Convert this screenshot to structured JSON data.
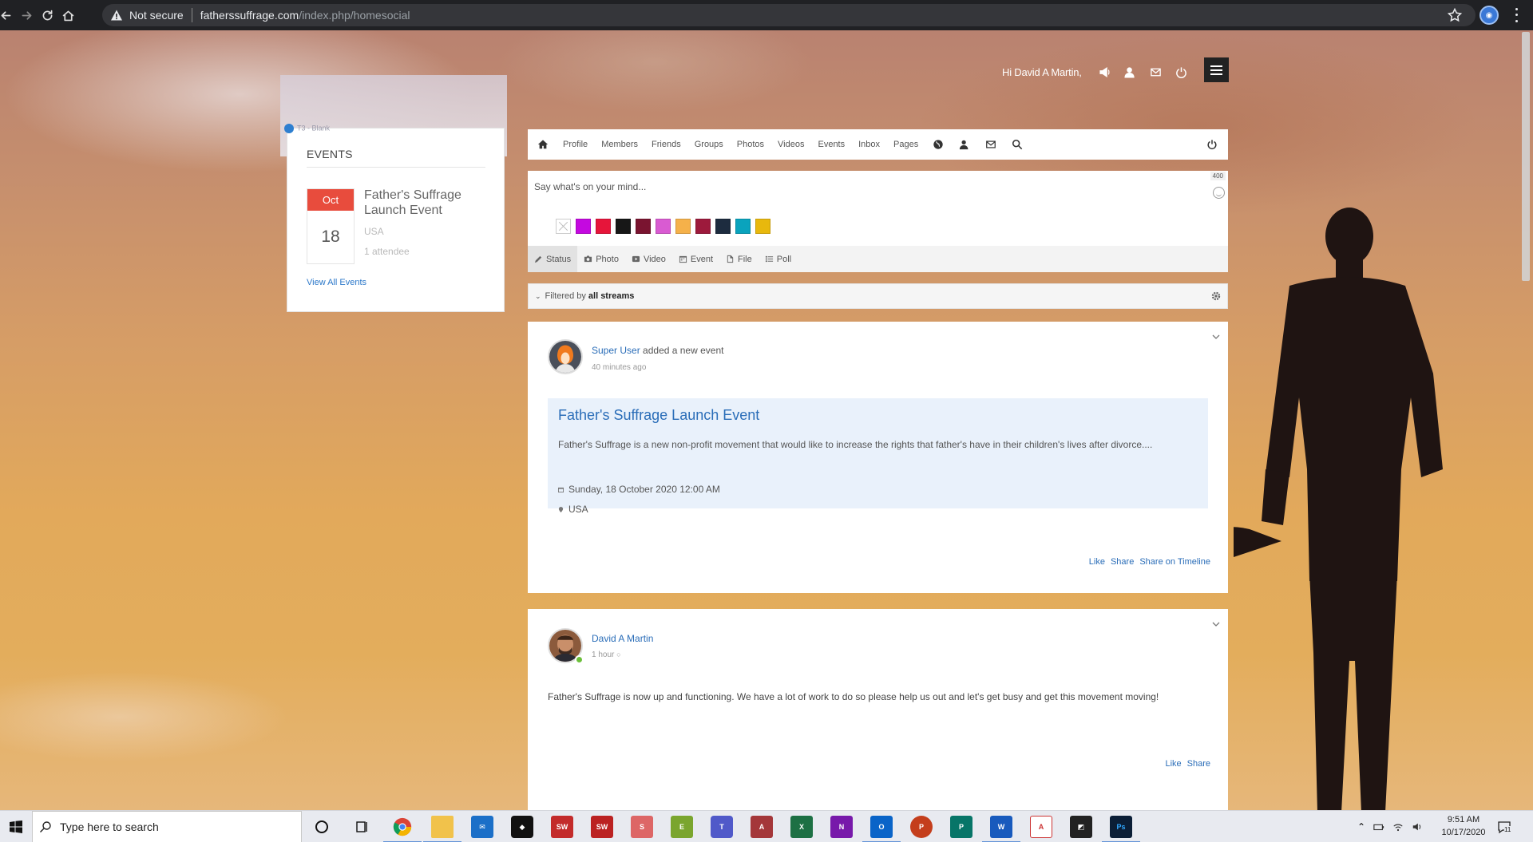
{
  "browser": {
    "security_label": "Not secure",
    "url_host": "fatherssuffrage.com",
    "url_path": "/index.php/homesocial"
  },
  "userbar": {
    "greeting": "Hi David A Martin,"
  },
  "events_widget": {
    "logo_text": "T3 - Blank",
    "heading": "EVENTS",
    "event": {
      "month": "Oct",
      "day": "18",
      "title": "Father's Suffrage Launch Event",
      "location": "USA",
      "attendees": "1 attendee"
    },
    "view_all": "View All Events"
  },
  "nav": {
    "items": [
      "Profile",
      "Members",
      "Friends",
      "Groups",
      "Photos",
      "Videos",
      "Events",
      "Inbox",
      "Pages"
    ]
  },
  "composer": {
    "placeholder": "Say what's on your mind...",
    "char_limit": "400",
    "tabs": [
      "Status",
      "Photo",
      "Video",
      "Event",
      "File",
      "Poll"
    ],
    "swatches": [
      "none",
      "#c409e0",
      "#e6153a",
      "#171717",
      "#7a1430",
      "#d95bd2",
      "#f5b14a",
      "#9d1a3c",
      "#1d2c3f",
      "#0aa3bd",
      "#e8b80d"
    ]
  },
  "filter": {
    "prefix": "Filtered by",
    "value": "all streams"
  },
  "posts": [
    {
      "author": "Super User",
      "action": "added a new event",
      "time": "40 minutes ago",
      "event_title": "Father's Suffrage Launch Event",
      "event_desc": "Father's Suffrage is a new non-profit movement that would like to increase the rights that father's have in their children's lives after divorce....",
      "event_date": "Sunday, 18 October 2020 12:00 AM",
      "event_location": "USA",
      "actions": [
        "Like",
        "Share",
        "Share on Timeline"
      ]
    },
    {
      "author": "David A Martin",
      "time": "1 hour",
      "text": "Father's Suffrage is now up and functioning. We have a lot of work to do so please help us out and let's get busy and get this movement moving!",
      "actions": [
        "Like",
        "Share"
      ]
    }
  ],
  "taskbar": {
    "search_placeholder": "Type here to search",
    "time": "9:51 AM",
    "date": "10/17/2020",
    "notification_count": "11"
  }
}
